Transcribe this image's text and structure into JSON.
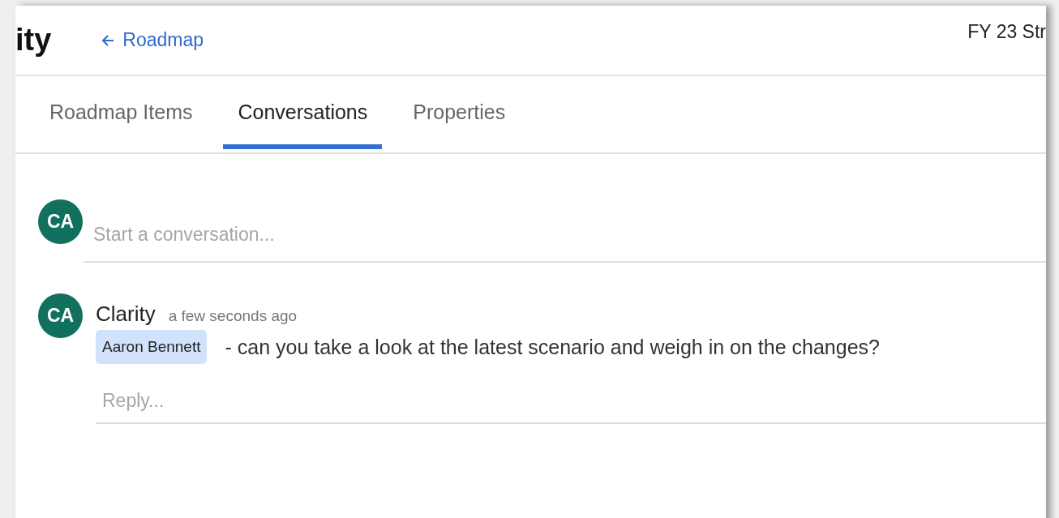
{
  "header": {
    "title": "ity",
    "back_link": "Roadmap",
    "plan_title": "FY 23 Str"
  },
  "tabs": [
    {
      "label": "Roadmap Items",
      "selected": false
    },
    {
      "label": "Conversations",
      "selected": true
    },
    {
      "label": "Properties",
      "selected": false
    }
  ],
  "composer": {
    "avatar": "CA",
    "placeholder": "Start a conversation..."
  },
  "comments": [
    {
      "avatar": "CA",
      "author": "Clarity",
      "time": "a few seconds ago",
      "mention": "Aaron Bennett",
      "text": "- can you take a look at the latest scenario and weigh in on the changes?",
      "reply_placeholder": "Reply..."
    }
  ]
}
